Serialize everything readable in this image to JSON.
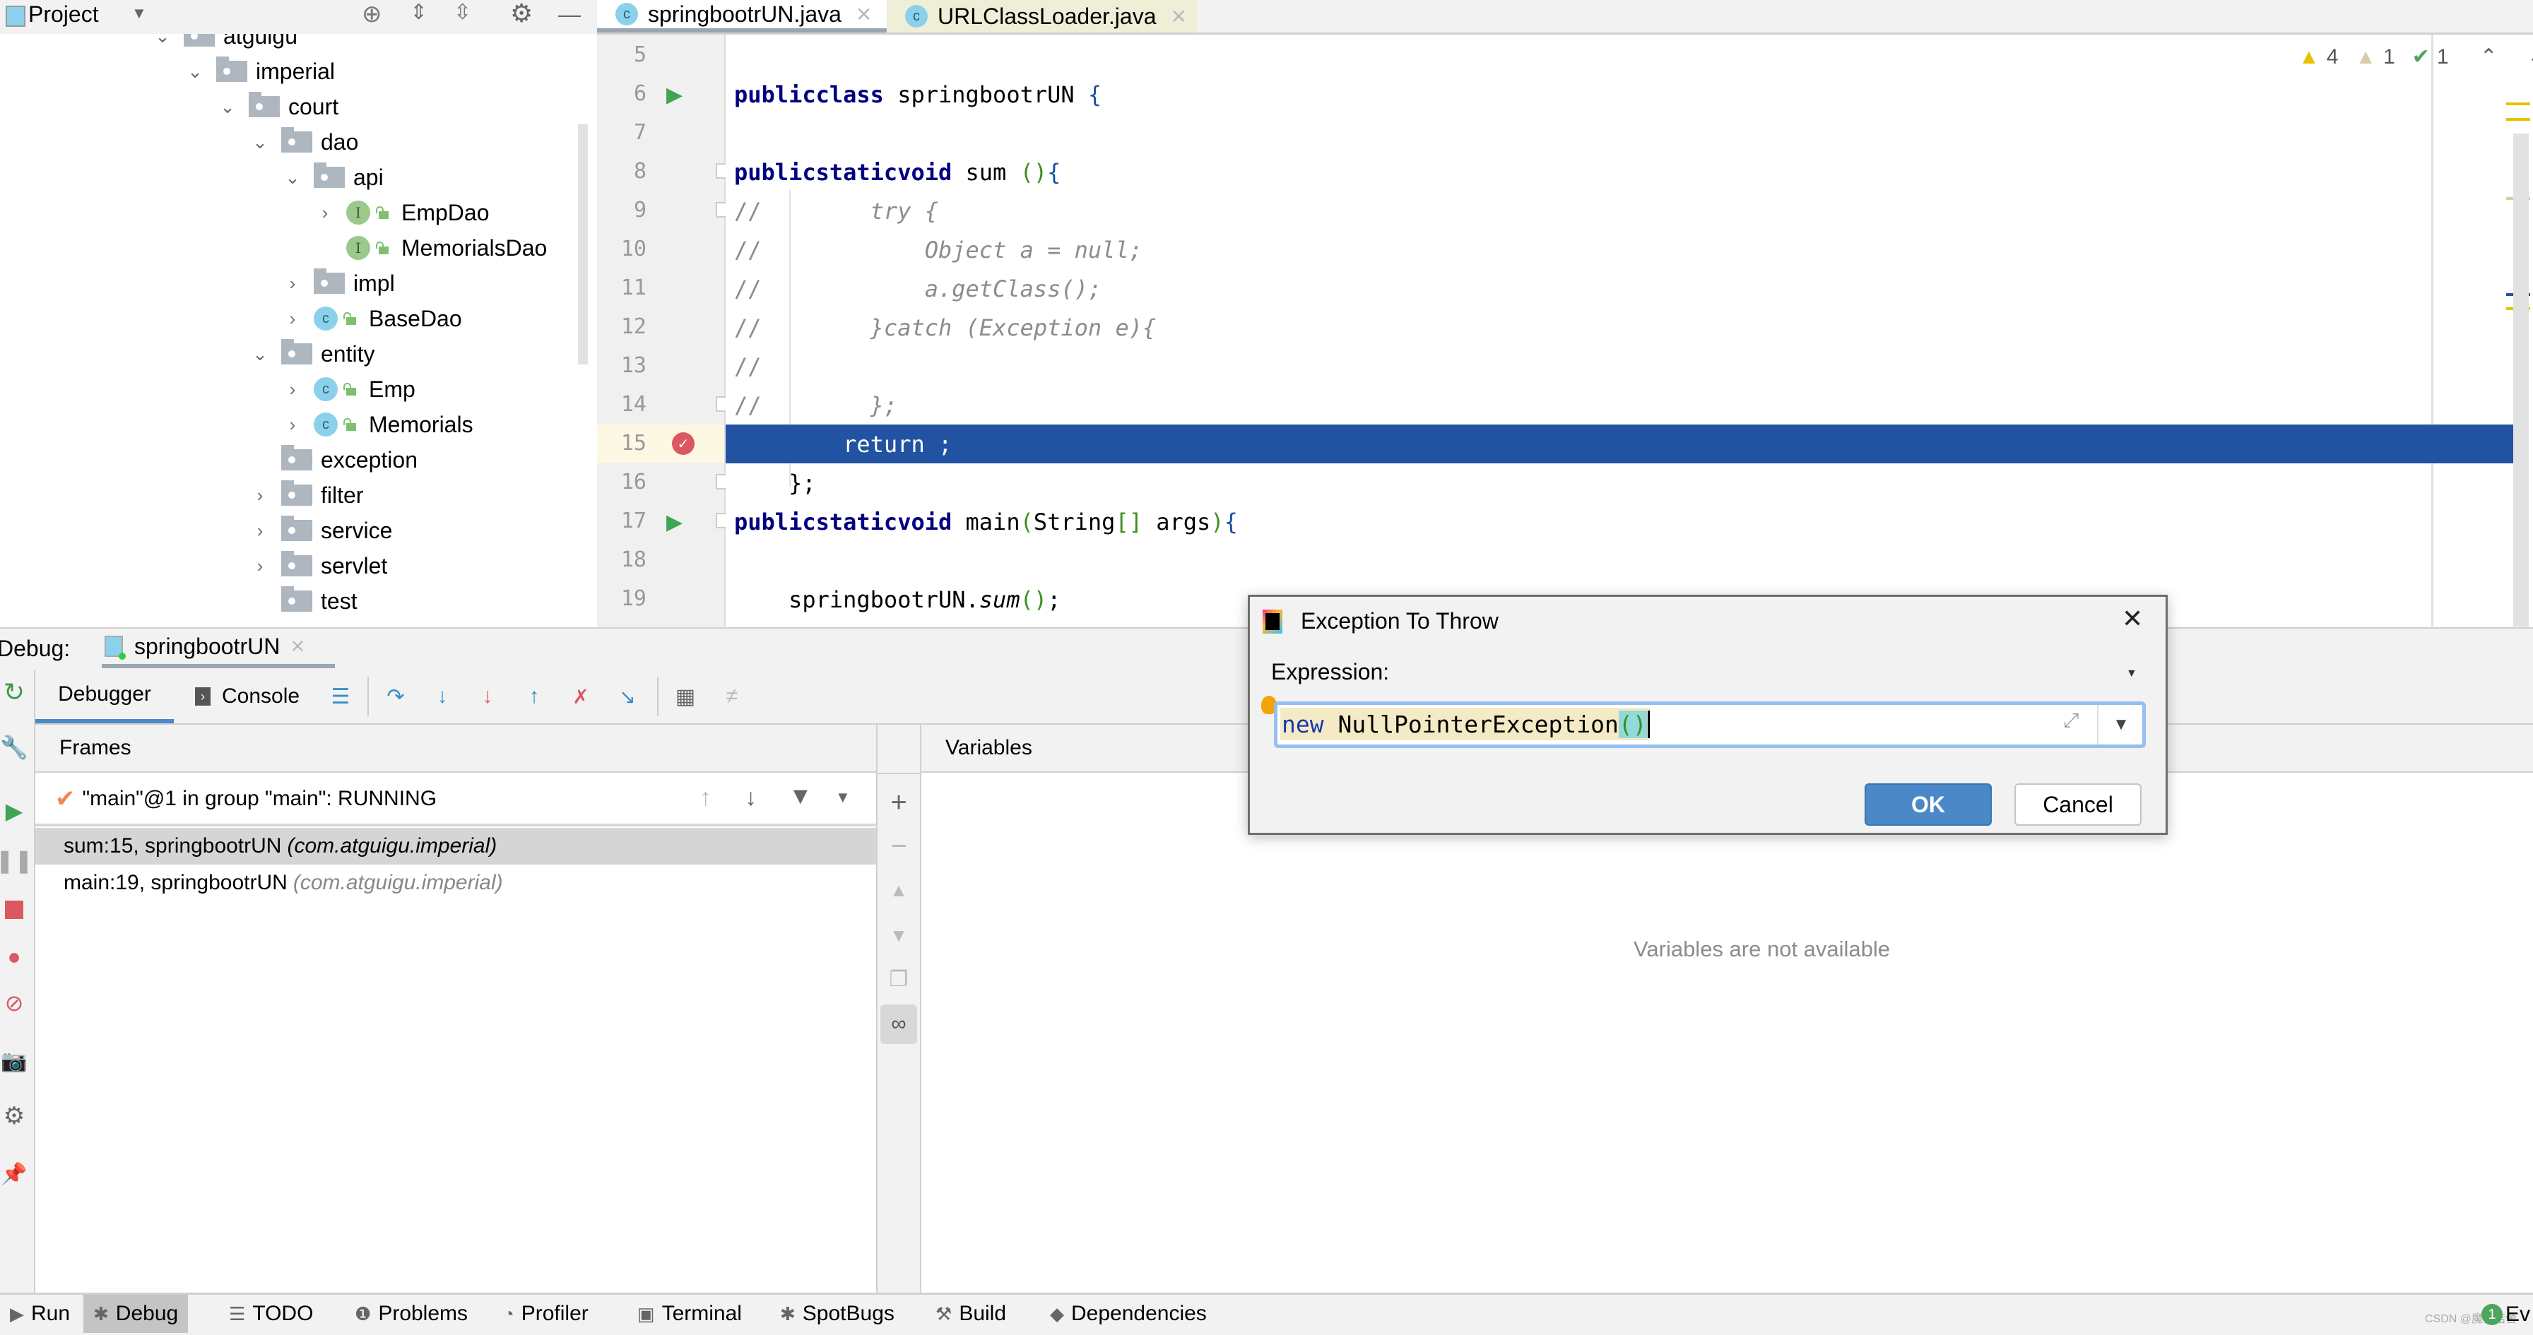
{
  "project_panel": {
    "title": "Project",
    "tree": [
      {
        "label": "atguigu",
        "type": "package",
        "expanded": true,
        "depth": 0
      },
      {
        "label": "imperial",
        "type": "package",
        "expanded": true,
        "depth": 1
      },
      {
        "label": "court",
        "type": "package",
        "expanded": true,
        "depth": 2
      },
      {
        "label": "dao",
        "type": "package",
        "expanded": true,
        "depth": 3
      },
      {
        "label": "api",
        "type": "package",
        "expanded": true,
        "depth": 4
      },
      {
        "label": "EmpDao",
        "type": "interface",
        "expanded": false,
        "depth": 5
      },
      {
        "label": "MemorialsDao",
        "type": "interface",
        "expanded": null,
        "depth": 5
      },
      {
        "label": "impl",
        "type": "package",
        "expanded": false,
        "depth": 4
      },
      {
        "label": "BaseDao",
        "type": "class",
        "expanded": false,
        "depth": 4
      },
      {
        "label": "entity",
        "type": "package",
        "expanded": true,
        "depth": 3
      },
      {
        "label": "Emp",
        "type": "class",
        "expanded": false,
        "depth": 4
      },
      {
        "label": "Memorials",
        "type": "class",
        "expanded": false,
        "depth": 4
      },
      {
        "label": "exception",
        "type": "package",
        "expanded": null,
        "depth": 3
      },
      {
        "label": "filter",
        "type": "package",
        "expanded": false,
        "depth": 3
      },
      {
        "label": "service",
        "type": "package",
        "expanded": false,
        "depth": 3
      },
      {
        "label": "servlet",
        "type": "package",
        "expanded": false,
        "depth": 3
      },
      {
        "label": "test",
        "type": "package",
        "expanded": null,
        "depth": 3
      }
    ]
  },
  "editor": {
    "tabs": [
      {
        "label": "springbootrUN.java",
        "active": true
      },
      {
        "label": "URLClassLoader.java",
        "active": false
      }
    ],
    "inspections": {
      "warnings": "4",
      "weak_warnings": "1",
      "typos": "1"
    },
    "lines": [
      {
        "n": "5",
        "text": ""
      },
      {
        "n": "6",
        "text": "public class springbootrUN {"
      },
      {
        "n": "7",
        "text": ""
      },
      {
        "n": "8",
        "text": "    public static void sum (){"
      },
      {
        "n": "9",
        "text": "//        try {"
      },
      {
        "n": "10",
        "text": "//            Object a = null;"
      },
      {
        "n": "11",
        "text": "//            a.getClass();"
      },
      {
        "n": "12",
        "text": "//        }catch (Exception e){"
      },
      {
        "n": "13",
        "text": "//"
      },
      {
        "n": "14",
        "text": "//        };"
      },
      {
        "n": "15",
        "text": "        return ;"
      },
      {
        "n": "16",
        "text": "    };"
      },
      {
        "n": "17",
        "text": "    public static void main(String[] args) {"
      },
      {
        "n": "18",
        "text": ""
      },
      {
        "n": "19",
        "text": "    springbootrUN.sum();"
      }
    ],
    "current_line": "15"
  },
  "debug": {
    "label": "Debug:",
    "session_tab": "springbootrUN",
    "tabs": {
      "debugger": "Debugger",
      "console": "Console"
    },
    "frames_header": "Frames",
    "variables_header": "Variables",
    "thread": "\"main\"@1 in group \"main\": RUNNING",
    "frames": [
      {
        "method": "sum:15, springbootrUN",
        "package": "(com.atguigu.imperial)",
        "selected": true
      },
      {
        "method": "main:19, springbootrUN",
        "package": "(com.atguigu.imperial)",
        "selected": false
      }
    ],
    "variables_empty": "Variables are not available"
  },
  "dialog": {
    "title": "Exception To Throw",
    "expression_label": "Expression:",
    "expression_value": "new NullPointerException()",
    "ok_label": "OK",
    "cancel_label": "Cancel"
  },
  "status_bar": {
    "items": [
      "Run",
      "Debug",
      "TODO",
      "Problems",
      "Profiler",
      "Terminal",
      "SpotBugs",
      "Build",
      "Dependencies"
    ],
    "active": "Debug",
    "event_count": "1",
    "event_label": "Ev",
    "watermark": "CSDN @魔仙结舍"
  },
  "colors": {
    "execution_line": "#2253a3",
    "ok_button": "#4a88c7",
    "keyword": "#000080",
    "comment": "#8c8c8c",
    "breakpoint": "#db5860"
  }
}
